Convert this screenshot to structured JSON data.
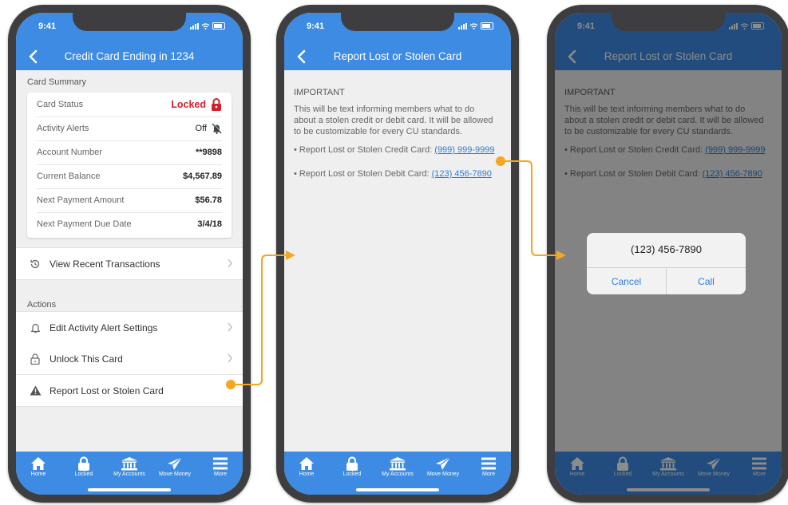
{
  "status": {
    "time": "9:41"
  },
  "screen1": {
    "title": "Credit Card Ending in 1234",
    "summary_header": "Card Summary",
    "summary": [
      {
        "label": "Card Status",
        "value": "Locked",
        "icon": "lock-icon"
      },
      {
        "label": "Activity Alerts",
        "value": "Off",
        "icon": "bell-off-icon"
      },
      {
        "label": "Account Number",
        "value": "**9898"
      },
      {
        "label": "Current Balance",
        "value": "$4,567.89"
      },
      {
        "label": "Next Payment Amount",
        "value": "$56.78"
      },
      {
        "label": "Next Payment Due Date",
        "value": "3/4/18"
      }
    ],
    "recent_transactions": "View Recent Transactions",
    "actions_header": "Actions",
    "actions": [
      {
        "label": "Edit Activity Alert Settings",
        "icon": "bell-icon"
      },
      {
        "label": "Unlock This Card",
        "icon": "lock-outline-icon"
      },
      {
        "label": "Report Lost or Stolen Card",
        "icon": "warning-icon"
      }
    ]
  },
  "screen2": {
    "title": "Report Lost or Stolen Card",
    "important": "IMPORTANT",
    "body_lines": [
      "This will be text informing members what to do",
      "about a stolen credit or debit card. It will be allowed",
      "to be customizable for every CU standards."
    ],
    "credit_label": "• Report Lost or Stolen Credit Card:",
    "credit_phone": "(999) 999-9999",
    "debit_label": "• Report Lost or Stolen Debit Card:",
    "debit_phone": "(123) 456-7890"
  },
  "dialog": {
    "number": "(123) 456-7890",
    "cancel": "Cancel",
    "call": "Call"
  },
  "tabs": [
    {
      "label": "Home",
      "icon": "home-icon"
    },
    {
      "label": "Locked",
      "icon": "lock-icon"
    },
    {
      "label": "My Accounts",
      "icon": "bank-icon"
    },
    {
      "label": "Move Money",
      "icon": "paper-plane-icon"
    },
    {
      "label": "More",
      "icon": "menu-icon"
    }
  ],
  "colors": {
    "primary": "#3d8be3",
    "locked": "#d51f2c",
    "connector": "#f5a623",
    "link": "#2f7fd8"
  }
}
